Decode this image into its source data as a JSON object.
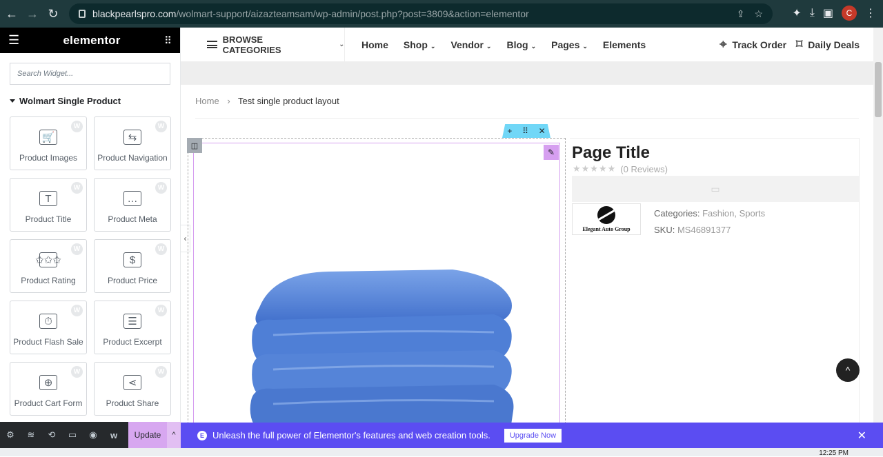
{
  "browser": {
    "url_host": "blackpearlspro.com",
    "url_path": "/wolmart-support/aizazteamsam/wp-admin/post.php?post=3809&action=elementor",
    "avatar_letter": "C"
  },
  "panel": {
    "logo": "elementor",
    "search_placeholder": "Search Widget...",
    "category": "Wolmart Single Product",
    "widgets": [
      {
        "label": "Product Images",
        "icon": "cart-image-icon"
      },
      {
        "label": "Product Navigation",
        "icon": "navigation-arrows-icon"
      },
      {
        "label": "Product Title",
        "icon": "text-title-icon"
      },
      {
        "label": "Product Meta",
        "icon": "chat-dots-icon"
      },
      {
        "label": "Product Rating",
        "icon": "rating-stars-icon"
      },
      {
        "label": "Product Price",
        "icon": "price-tag-icon"
      },
      {
        "label": "Product Flash Sale",
        "icon": "stopwatch-icon"
      },
      {
        "label": "Product Excerpt",
        "icon": "document-icon"
      },
      {
        "label": "Product Cart Form",
        "icon": "add-cart-icon"
      },
      {
        "label": "Product Share",
        "icon": "share-icon"
      }
    ],
    "update_label": "Update"
  },
  "notice": {
    "text": "Unleash the full power of Elementor's features and web creation tools.",
    "upgrade_label": "Upgrade Now"
  },
  "site": {
    "browse": "BROWSE CATEGORIES",
    "menu": [
      "Home",
      "Shop",
      "Vendor",
      "Blog",
      "Pages",
      "Elements"
    ],
    "track_order": "Track Order",
    "daily_deals": "Daily Deals"
  },
  "breadcrumb": {
    "home": "Home",
    "current": "Test single product layout"
  },
  "product": {
    "title": "Page Title",
    "reviews": "(0 Reviews)",
    "rating_value": 0,
    "brand_name": "Elegant Auto Group",
    "categories_label": "Categories:",
    "categories": "Fashion, Sports",
    "sku_label": "SKU:",
    "sku": "MS46891377"
  },
  "taskbar": {
    "time": "12:25 PM"
  },
  "colors": {
    "elementor_pink": "#d69ff0",
    "notice_purple": "#5b4df2",
    "section_blue": "#71d7f7",
    "chrome_bg": "#1f3a3d"
  }
}
